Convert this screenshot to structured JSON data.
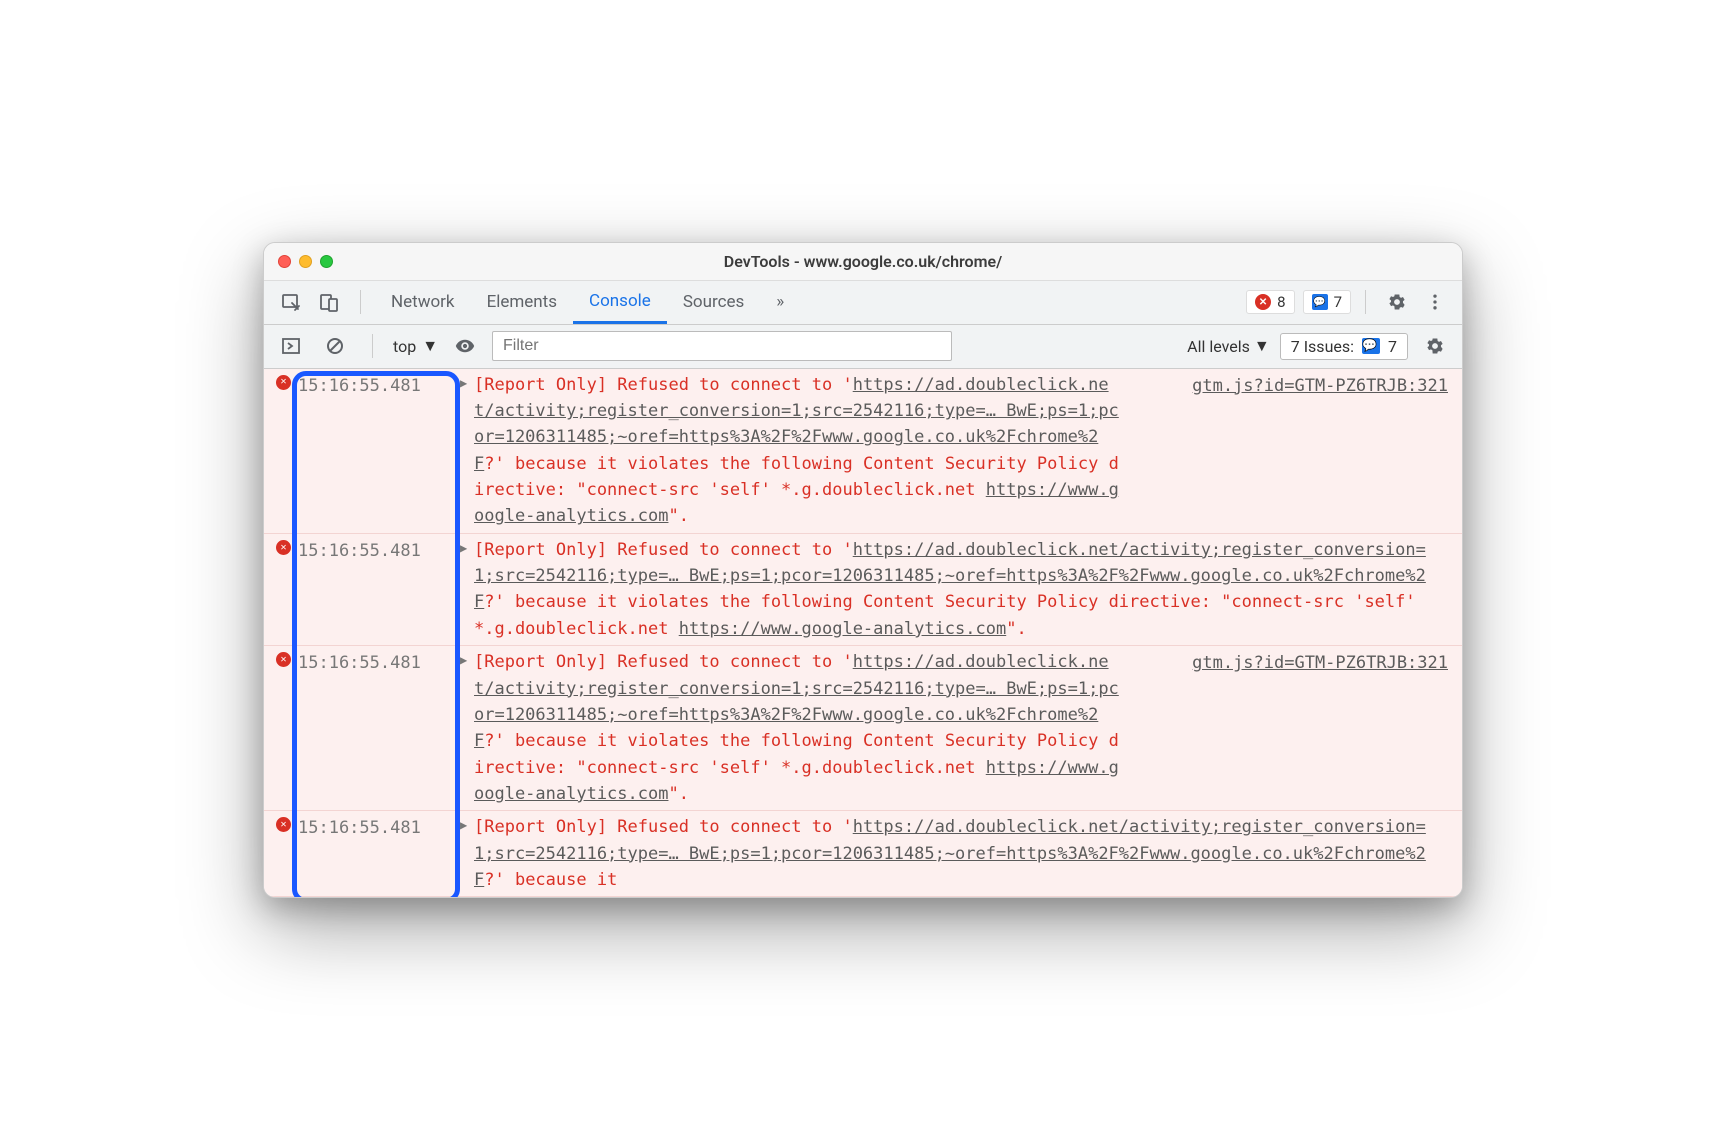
{
  "window": {
    "title": "DevTools - www.google.co.uk/chrome/"
  },
  "tabbar": {
    "tabs": [
      "Network",
      "Elements",
      "Console",
      "Sources"
    ],
    "more": "»",
    "errors_count": "8",
    "messages_count": "7"
  },
  "filterbar": {
    "context": "top",
    "filter_placeholder": "Filter",
    "levels": "All levels",
    "issues_label": "7 Issues:",
    "issues_count": "7"
  },
  "messages": [
    {
      "timestamp": "15:16:55.481",
      "source": "gtm.js?id=GTM-PZ6TRJB:321",
      "parts": [
        {
          "t": "[Report Only] Refused to connect to '"
        },
        {
          "u": "https://ad.doubleclick.net/activity;register_conversion=1;src=2542116;type=… BwE;ps=1;pcor=1206311485;~oref=https%3A%2F%2Fwww.google.co.uk%2Fchrome%2F"
        },
        {
          "t": "?' because it violates the following Content Security Policy directive: \"connect-src 'self' *.g.doubleclick.net "
        },
        {
          "u": "https://www.google-analytics.com"
        },
        {
          "t": "\"."
        }
      ]
    },
    {
      "timestamp": "15:16:55.481",
      "source": "",
      "parts": [
        {
          "t": "[Report Only] Refused to connect to '"
        },
        {
          "u": "https://ad.doubleclick.net/activity;register_conversion=1;src=2542116;type=… BwE;ps=1;pcor=1206311485;~oref=https%3A%2F%2Fwww.google.co.uk%2Fchrome%2F"
        },
        {
          "t": "?' because it violates the following Content Security Policy directive: \"connect-src 'self' *.g.doubleclick.net "
        },
        {
          "u": "https://www.google-analytics.com"
        },
        {
          "t": "\"."
        }
      ]
    },
    {
      "timestamp": "15:16:55.481",
      "source": "gtm.js?id=GTM-PZ6TRJB:321",
      "parts": [
        {
          "t": "[Report Only] Refused to connect to '"
        },
        {
          "u": "https://ad.doubleclick.net/activity;register_conversion=1;src=2542116;type=… BwE;ps=1;pcor=1206311485;~oref=https%3A%2F%2Fwww.google.co.uk%2Fchrome%2F"
        },
        {
          "t": "?' because it violates the following Content Security Policy directive: \"connect-src 'self' *.g.doubleclick.net "
        },
        {
          "u": "https://www.google-analytics.com"
        },
        {
          "t": "\"."
        }
      ]
    },
    {
      "timestamp": "15:16:55.481",
      "source": "",
      "parts": [
        {
          "t": "[Report Only] Refused to connect to '"
        },
        {
          "u": "https://ad.doubleclick.net/activity;register_conversion=1;src=2542116;type=… BwE;ps=1;pcor=1206311485;~oref=https%3A%2F%2Fwww.google.co.uk%2Fchrome%2F"
        },
        {
          "t": "?' because it "
        }
      ]
    }
  ]
}
